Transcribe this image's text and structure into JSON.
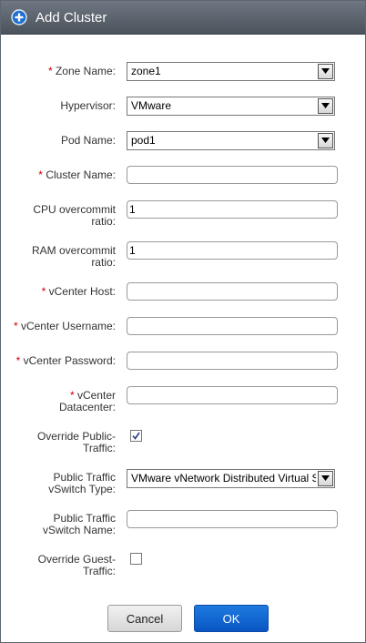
{
  "dialog": {
    "title": "Add Cluster"
  },
  "form": {
    "zone_name": {
      "required": "*",
      "label": "Zone Name:",
      "value": "zone1"
    },
    "hypervisor": {
      "label": "Hypervisor:",
      "value": "VMware"
    },
    "pod_name": {
      "label": "Pod Name:",
      "value": "pod1"
    },
    "cluster_name": {
      "required": "*",
      "label": "Cluster Name:",
      "value": ""
    },
    "cpu_overcommit": {
      "label_1": "CPU overcommit",
      "label_2": "ratio:",
      "value": "1"
    },
    "ram_overcommit": {
      "label_1": "RAM overcommit",
      "label_2": "ratio:",
      "value": "1"
    },
    "vcenter_host": {
      "required": "*",
      "label": "vCenter Host:",
      "value": ""
    },
    "vcenter_username": {
      "required": "*",
      "label": "vCenter Username:",
      "value": ""
    },
    "vcenter_password": {
      "required": "*",
      "label": "vCenter Password:",
      "value": ""
    },
    "vcenter_datacenter": {
      "required": "*",
      "label_1": "vCenter",
      "label_2": "Datacenter:",
      "value": ""
    },
    "override_public": {
      "label_1": "Override Public-",
      "label_2": "Traffic:",
      "checked": true
    },
    "public_vswitch_type": {
      "label_1": "Public Traffic",
      "label_2": "vSwitch Type:",
      "value": "VMware vNetwork Distributed Virtual Switch"
    },
    "public_vswitch_name": {
      "label_1": "Public Traffic",
      "label_2": "vSwitch Name:",
      "value": ""
    },
    "override_guest": {
      "label_1": "Override Guest-",
      "label_2": "Traffic:",
      "checked": false
    }
  },
  "buttons": {
    "cancel": "Cancel",
    "ok": "OK"
  },
  "icons": {
    "title_icon": "add-circle-icon",
    "dropdown": "chevron-down-icon",
    "check": "checkmark-icon"
  }
}
